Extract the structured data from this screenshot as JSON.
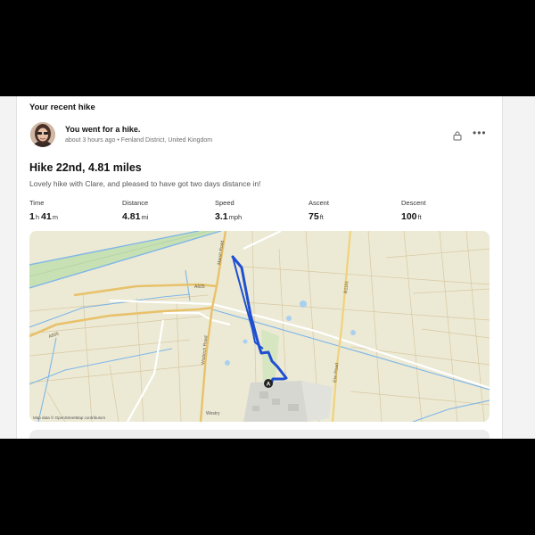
{
  "section": {
    "title": "Your recent hike"
  },
  "activity": {
    "headline": "You went for a hike.",
    "time_ago": "about 3 hours ago",
    "separator": "•",
    "location": "Fenland District, United Kingdom",
    "title": "Hike 22nd, 4.81 miles",
    "description": "Lovely hike with Clare, and pleased to have got two days distance in!"
  },
  "stats": {
    "time": {
      "label": "Time",
      "hours": "1",
      "hours_unit": "h",
      "minutes": "41",
      "minutes_unit": "m"
    },
    "distance": {
      "label": "Distance",
      "value": "4.81",
      "unit": "mi"
    },
    "speed": {
      "label": "Speed",
      "value": "3.1",
      "unit": "mph"
    },
    "ascent": {
      "label": "Ascent",
      "value": "75",
      "unit": "ft"
    },
    "descent": {
      "label": "Descent",
      "value": "100",
      "unit": "ft"
    }
  },
  "map": {
    "credit": "Map data © OpenStreetMap contributors",
    "road_labels": {
      "a605": "A605",
      "a605_west": "A605",
      "marsh_road": "Marsh Road",
      "wisbech_road": "Wisbech Road",
      "elm_road": "Elm Road",
      "b1101": "B1101"
    },
    "places": {
      "westry": "Westry"
    },
    "start_marker": "A",
    "colors": {
      "route": "#1f4fd1",
      "land": "#ecead5",
      "road_major": "#e8c16a",
      "water": "#7fb6e8",
      "green": "#c7e0b4"
    }
  },
  "icons": {
    "lock": "lock-icon",
    "more": "more-options-icon"
  }
}
